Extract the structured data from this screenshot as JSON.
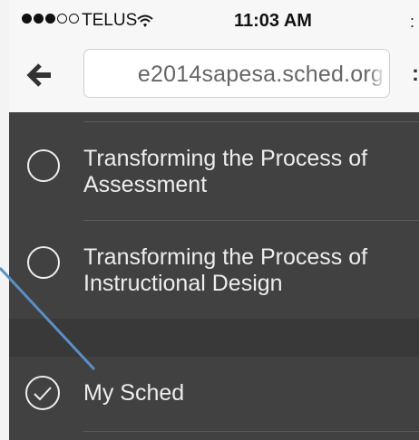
{
  "status_bar": {
    "signal_dots_filled": 3,
    "signal_dots_empty": 2,
    "carrier": "TELUS",
    "wifi_icon": "wifi-icon",
    "time": "11:03 AM"
  },
  "nav": {
    "back_icon": "back-arrow-icon",
    "url": "e2014sapesa.sched.org"
  },
  "menu": {
    "items": [
      {
        "label": "Transforming the Process of Assessment",
        "icon": "circle-icon",
        "selected": false
      },
      {
        "label": "Transforming the Process of Instructional Design",
        "icon": "circle-icon",
        "selected": false
      },
      {
        "label": "My Sched",
        "icon": "checkmark-circle-icon",
        "selected": true
      }
    ]
  },
  "colors": {
    "menu_background": "#414141",
    "annotation_line": "#5b8fc7",
    "text_light": "#ededed"
  }
}
